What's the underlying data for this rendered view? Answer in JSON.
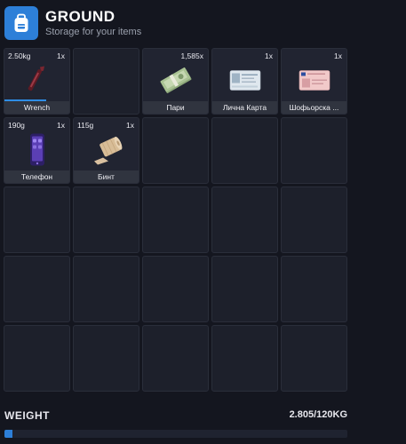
{
  "header": {
    "title": "GROUND",
    "subtitle": "Storage for your items",
    "icon": "backpack-icon",
    "accent": "#2d7fd8"
  },
  "slots": [
    {
      "weight": "2.50kg",
      "qty": "1x",
      "label": "Wrench",
      "icon": "wrench-icon",
      "durability": 0.64
    },
    {},
    {
      "weight": "",
      "qty": "1,585x",
      "label": "Пари",
      "icon": "money-icon"
    },
    {
      "weight": "",
      "qty": "1x",
      "label": "Лична Карта",
      "icon": "id-card-icon"
    },
    {
      "weight": "",
      "qty": "1x",
      "label": "Шофьорска ...",
      "icon": "drivers-license-icon"
    },
    {
      "weight": "190g",
      "qty": "1x",
      "label": "Телефон",
      "icon": "phone-icon"
    },
    {
      "weight": "115g",
      "qty": "1x",
      "label": "Бинт",
      "icon": "bandage-icon"
    },
    {},
    {},
    {},
    {},
    {},
    {},
    {},
    {},
    {},
    {},
    {},
    {},
    {},
    {},
    {},
    {},
    {},
    {}
  ],
  "weight": {
    "label": "WEIGHT",
    "value": "2.805/120KG",
    "fraction": 0.0234
  }
}
